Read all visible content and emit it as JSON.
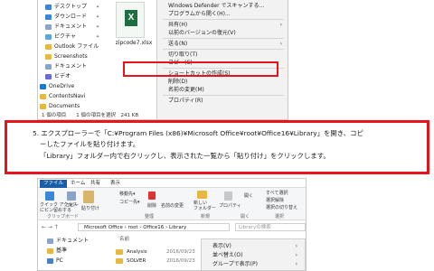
{
  "top": {
    "nav_items": [
      {
        "label": "デスクトップ",
        "pin": true,
        "color": "#3a86d9"
      },
      {
        "label": "ダウンロード",
        "pin": true,
        "color": "#3a86d9"
      },
      {
        "label": "ドキュメント",
        "pin": true,
        "color": "#8aa4c8"
      },
      {
        "label": "ピクチャ",
        "pin": true,
        "color": "#5aa6d8"
      },
      {
        "label": "Outlook ファイル",
        "pin": false,
        "color": "#e7b73f"
      },
      {
        "label": "Screenshots",
        "pin": false,
        "color": "#e7b73f"
      },
      {
        "label": "ドキュメント",
        "pin": false,
        "color": "#8aa4c8"
      },
      {
        "label": "ビデオ",
        "pin": false,
        "color": "#6b6bd6"
      },
      {
        "label": "OneDrive",
        "pin": false,
        "color": "#1e78d4"
      },
      {
        "label": "ContentsNavi",
        "pin": false,
        "color": "#e7b73f"
      },
      {
        "label": "Documents",
        "pin": false,
        "color": "#e7b73f"
      }
    ],
    "file_name": "zipcode7.xlsx",
    "file_icon_letter": "X",
    "context_menu": [
      {
        "label": "Windows Defender でスキャンする...",
        "arrow": false
      },
      {
        "label": "プログラムから開く(H)...",
        "arrow": false
      },
      {
        "sep": true
      },
      {
        "label": "共有(H)",
        "arrow": true
      },
      {
        "label": "以前のバージョンの復元(V)",
        "arrow": false
      },
      {
        "sep": true
      },
      {
        "label": "送る(N)",
        "arrow": true
      },
      {
        "sep": true
      },
      {
        "label": "切り取り(T)",
        "arrow": false
      },
      {
        "label": "コピー(C)",
        "arrow": false
      },
      {
        "sep": true
      },
      {
        "label": "ショートカットの作成(S)",
        "arrow": false
      },
      {
        "label": "削除(D)",
        "arrow": false
      },
      {
        "label": "名前の変更(M)",
        "arrow": false
      },
      {
        "sep": true
      },
      {
        "label": "プロパティ(R)",
        "arrow": false
      }
    ],
    "status": "1 個の項目　　1 個の項目を選択　241 KB"
  },
  "step": {
    "line1": "5. エクスプローラーで「C:¥Program Files (x86)¥Microsoft Office¥root¥Office16¥Library」を開き、コピ",
    "line2": "ーしたファイルを貼り付けます。",
    "line3": "「Library」フォルダー内で右クリックし、表示された一覧から「貼り付け」をクリックします。"
  },
  "bottom": {
    "tabs": [
      "ファイル",
      "ホーム",
      "共有",
      "表示"
    ],
    "ribbon": {
      "pin_label": "クイック アクセス\nにピン留めする",
      "copy_label": "コピー",
      "paste_label": "貼り付け",
      "move_label": "移動先▾",
      "copy_to_label": "コピー先▾",
      "delete_label": "削除",
      "rename_label": "名前の変更",
      "new_label": "新しい\nフォルダー",
      "open_label": "開く",
      "props_label": "プロパティ",
      "select_all": "すべて選択",
      "select_none": "選択解除",
      "invert": "選択の切り替え",
      "group_clipboard": "クリップボード",
      "group_organize": "整理",
      "group_new": "新規",
      "group_open": "開く",
      "group_select": "選択"
    },
    "address": "Microsoft Office › root › Office16 › Library",
    "search_placeholder": "Libraryの検索",
    "nav_items": [
      {
        "label": "ドキュメント",
        "color": "#8aa4c8"
      },
      {
        "label": "基準",
        "color": "#e7b73f"
      },
      {
        "label": "PC",
        "color": "#4a7fc1"
      }
    ],
    "list_header": "名前",
    "files": [
      {
        "name": "Analysis",
        "date": "2016/09/23"
      },
      {
        "name": "SOLVER",
        "date": "2016/09/23"
      }
    ],
    "context_menu": [
      {
        "label": "表示(V)",
        "arrow": true
      },
      {
        "label": "並べ替え(O)",
        "arrow": true
      },
      {
        "label": "グループで表示(P)",
        "arrow": true
      }
    ]
  },
  "colors": {
    "highlight": "#e8141b",
    "excel": "#1d6f42",
    "file_tab": "#1a5ea8"
  }
}
